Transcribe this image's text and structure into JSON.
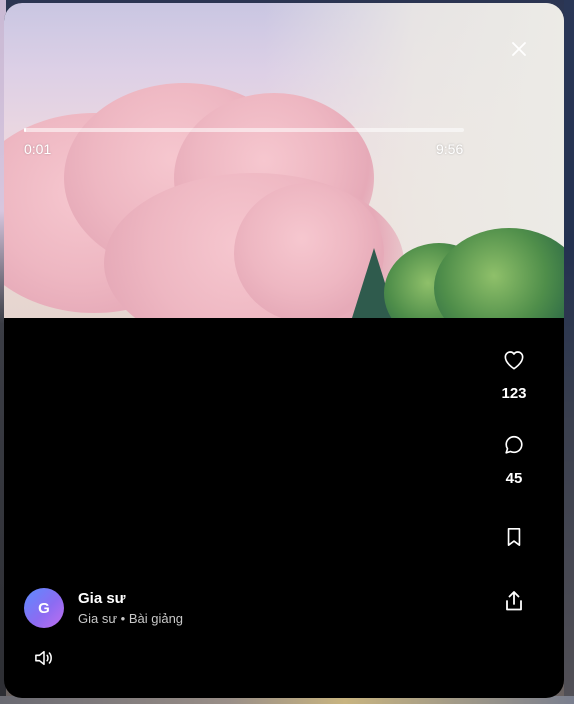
{
  "player": {
    "close_icon": "close-icon",
    "progress": {
      "current_time": "0:01",
      "total_time": "9:56",
      "fraction": 0.002
    },
    "actions": {
      "like": {
        "icon": "heart-icon",
        "count": "123"
      },
      "comment": {
        "icon": "comment-icon",
        "count": "45"
      },
      "bookmark": {
        "icon": "bookmark-icon"
      },
      "share": {
        "icon": "share-icon"
      }
    },
    "author": {
      "avatar_initial": "G",
      "name": "Gia sư",
      "subtitle": "Gia sư • Bài giảng"
    },
    "volume_icon": "volume-icon"
  },
  "colors": {
    "player_background": "#000000",
    "text_primary": "#ffffff",
    "text_secondary": "#c8c8c8",
    "avatar_gradient_start": "#5b8cff",
    "avatar_gradient_end": "#c06ef0"
  }
}
